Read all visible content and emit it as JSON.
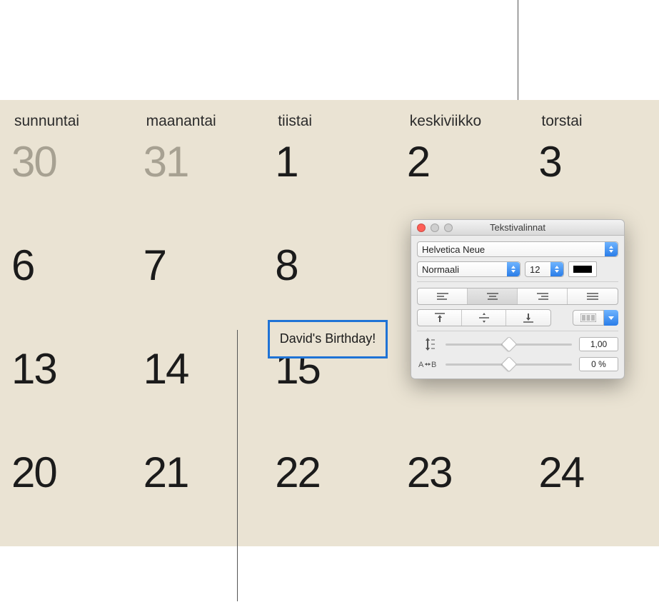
{
  "calendar": {
    "day_headers": [
      "sunnuntai",
      "maanantai",
      "tiistai",
      "keskiviikko",
      "torstai"
    ],
    "rows": [
      [
        {
          "n": "30",
          "muted": true
        },
        {
          "n": "31",
          "muted": true
        },
        {
          "n": "1"
        },
        {
          "n": "2"
        },
        {
          "n": "3"
        }
      ],
      [
        {
          "n": "6"
        },
        {
          "n": "7"
        },
        {
          "n": "8"
        },
        {
          "n": ""
        },
        {
          "n": ""
        }
      ],
      [
        {
          "n": "13"
        },
        {
          "n": "14"
        },
        {
          "n": "15"
        },
        {
          "n": ""
        },
        {
          "n": ""
        }
      ],
      [
        {
          "n": "20"
        },
        {
          "n": "21"
        },
        {
          "n": "22"
        },
        {
          "n": "23"
        },
        {
          "n": "24"
        }
      ]
    ],
    "event_text": "David's Birthday!"
  },
  "panel": {
    "title": "Tekstivalinnat",
    "font_family": "Helvetica Neue",
    "font_style": "Normaali",
    "font_size": "12",
    "line_spacing_value": "1,00",
    "tracking_value": "0 %"
  }
}
